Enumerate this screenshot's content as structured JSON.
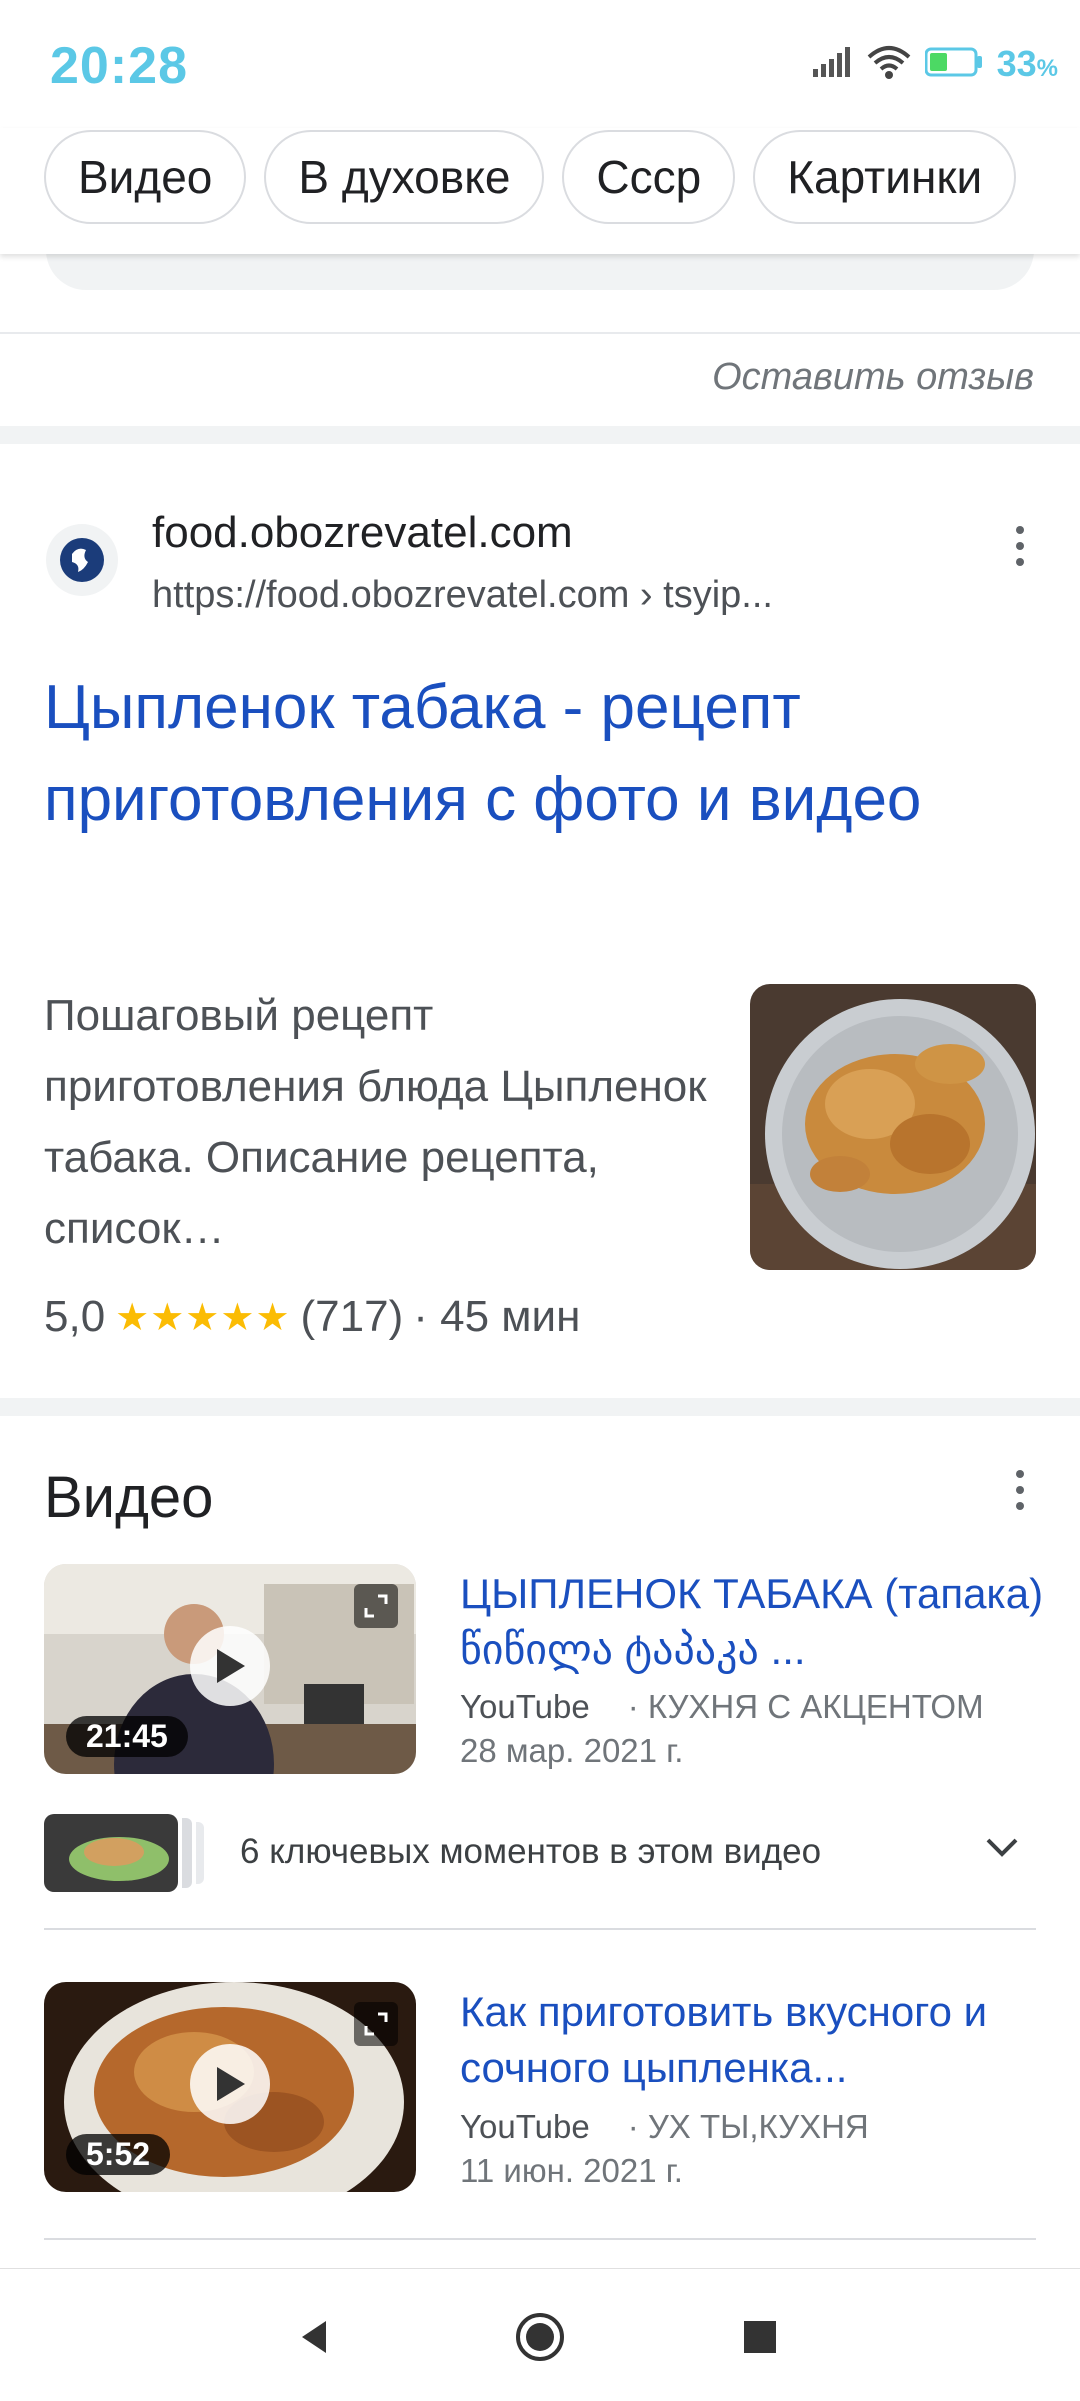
{
  "status_bar": {
    "time": "20:28",
    "battery": "33",
    "battery_unit": "%"
  },
  "chips": [
    "Видео",
    "В духовке",
    "Ссср",
    "Картинки"
  ],
  "feedback": {
    "label": "Оставить отзыв"
  },
  "result": {
    "site_name": "food.obozrevatel.com",
    "url": "https://food.obozrevatel.com › tsyip...",
    "title": "Цыпленок табака - рецепт приготовления с фото и видео",
    "snippet": "Пошаговый рецепт приготовления блюда Цыпленок табака. Описание рецепта, список…",
    "rating_value": "5,0",
    "stars": "★★★★★",
    "rating_count": "(717)",
    "time": "· 45 мин"
  },
  "videos": {
    "heading": "Видео",
    "items": [
      {
        "title": "ЦЫПЛЕНОК ТАБАКА (тапака) წიწილა ტაპაკა ...",
        "source": "YouTube",
        "channel": "· КУХНЯ С АКЦЕНТОМ",
        "date": "28 мар. 2021 г.",
        "duration": "21:45"
      },
      {
        "title": "Как приготовить вкусного и сочного цыпленка...",
        "source": "YouTube",
        "channel": "· УХ ТЫ,КУХНЯ",
        "date": "11 июн. 2021 г.",
        "duration": "5:52"
      }
    ],
    "key_moments": "6 ключевых моментов в этом видео"
  },
  "colors": {
    "link": "#1a4fbf",
    "status_accent": "#5bc8e6",
    "stars": "#fbbc04"
  },
  "icons": [
    "signal-icon",
    "wifi-icon",
    "battery-icon",
    "globe-icon",
    "kebab-menu-icon",
    "play-icon",
    "expand-icon",
    "chevron-down-icon",
    "back-icon",
    "home-icon",
    "recents-icon"
  ]
}
